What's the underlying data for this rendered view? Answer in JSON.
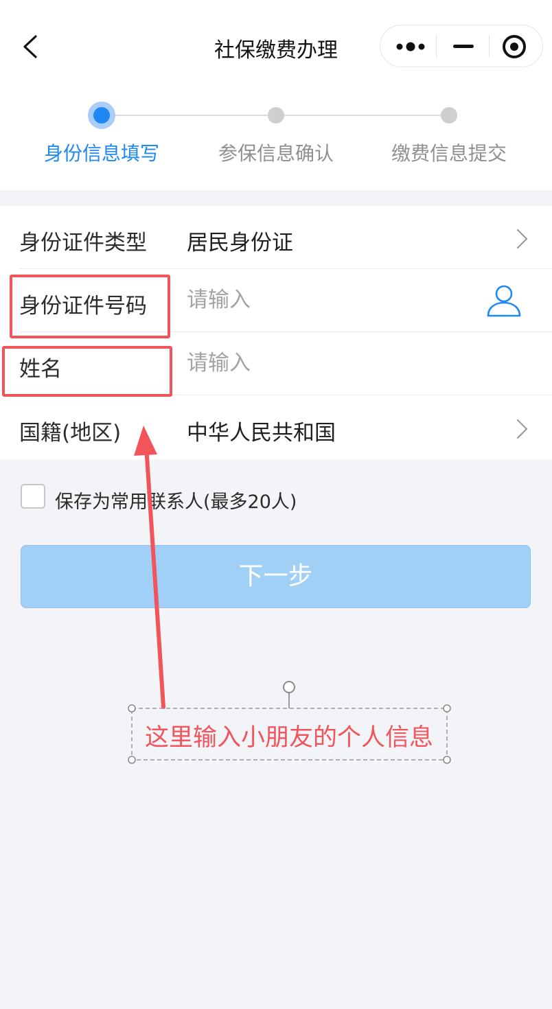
{
  "header": {
    "title": "社保缴费办理",
    "back_icon": "chevron-left-icon",
    "capsule": {
      "more_icon": "more-dots-icon",
      "minimize_icon": "minus-icon",
      "close_icon": "target-circle-icon"
    }
  },
  "steps": [
    {
      "label": "身份信息填写",
      "state": "active"
    },
    {
      "label": "参保信息确认",
      "state": "pending"
    },
    {
      "label": "缴费信息提交",
      "state": "pending"
    }
  ],
  "form": {
    "id_type": {
      "label": "身份证件类型",
      "value": "居民身份证"
    },
    "id_number": {
      "label": "身份证件号码",
      "placeholder": "请输入",
      "icon": "person-icon"
    },
    "name": {
      "label": "姓名",
      "placeholder": "请输入"
    },
    "nationality": {
      "label": "国籍(地区)",
      "value": "中华人民共和国"
    }
  },
  "save_contact": {
    "label": "保存为常用联系人(最多20人)",
    "checked": false
  },
  "next_button": {
    "label": "下一步"
  },
  "annotation": {
    "text": "这里输入小朋友的个人信息"
  },
  "colors": {
    "accent": "#1e88f5",
    "button": "#a0d0f6",
    "highlight": "#f2545b",
    "background": "#f3f4f8"
  }
}
